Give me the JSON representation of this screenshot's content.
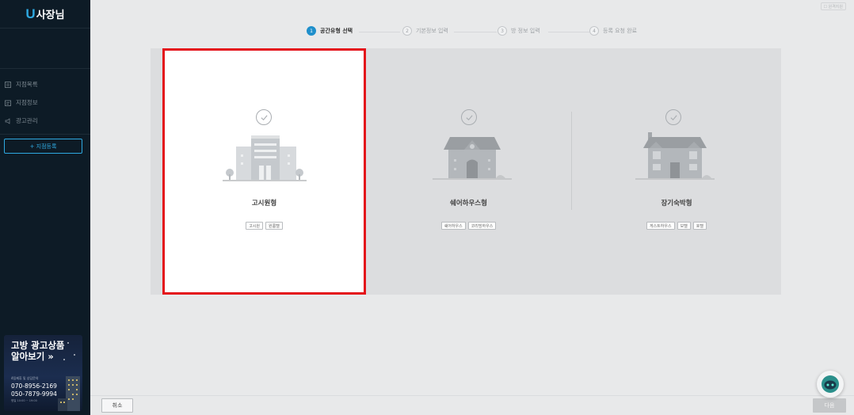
{
  "sidebar": {
    "logo_u": "U",
    "logo_text": "사장님",
    "menu": [
      {
        "label": "지점목록",
        "icon": "list-icon"
      },
      {
        "label": "지점정보",
        "icon": "info-card-icon"
      },
      {
        "label": "광고관리",
        "icon": "megaphone-icon"
      }
    ],
    "add_branch_label": "+ 지점등록",
    "promo": {
      "title_line1": "고방 광고상품",
      "title_line2": "알아보기 »",
      "sub": "4팀제휴 및 상담문의",
      "phone1": "070-8956-2169",
      "phone2": "050-7879-9994",
      "hours": "평일 10:00 ~ 19:00"
    }
  },
  "header": {
    "support_label": "☐ 원격지원"
  },
  "steps": [
    {
      "num": "1",
      "label": "공간유형 선택",
      "active": true
    },
    {
      "num": "2",
      "label": "기본정보 입력",
      "active": false
    },
    {
      "num": "3",
      "label": "방 정보 입력",
      "active": false
    },
    {
      "num": "4",
      "label": "등록 요청 완료",
      "active": false
    }
  ],
  "cards": [
    {
      "title": "고시원형",
      "tags": [
        "고시원",
        "원룸텔"
      ],
      "selected": true,
      "icon": "office-building-icon"
    },
    {
      "title": "쉐어하우스형",
      "tags": [
        "쉐어하우스",
        "코리빙하우스"
      ],
      "selected": false,
      "icon": "house-icon"
    },
    {
      "title": "장기숙박형",
      "tags": [
        "게스트하우스",
        "모텔",
        "호텔"
      ],
      "selected": false,
      "icon": "lodge-icon"
    }
  ],
  "footer": {
    "cancel_label": "취소",
    "next_label": "다음"
  },
  "colors": {
    "sidebar_bg": "#0d1b26",
    "accent": "#1f8fcb",
    "selection_border": "#e4121a",
    "panel_bg": "#dcdddf"
  }
}
